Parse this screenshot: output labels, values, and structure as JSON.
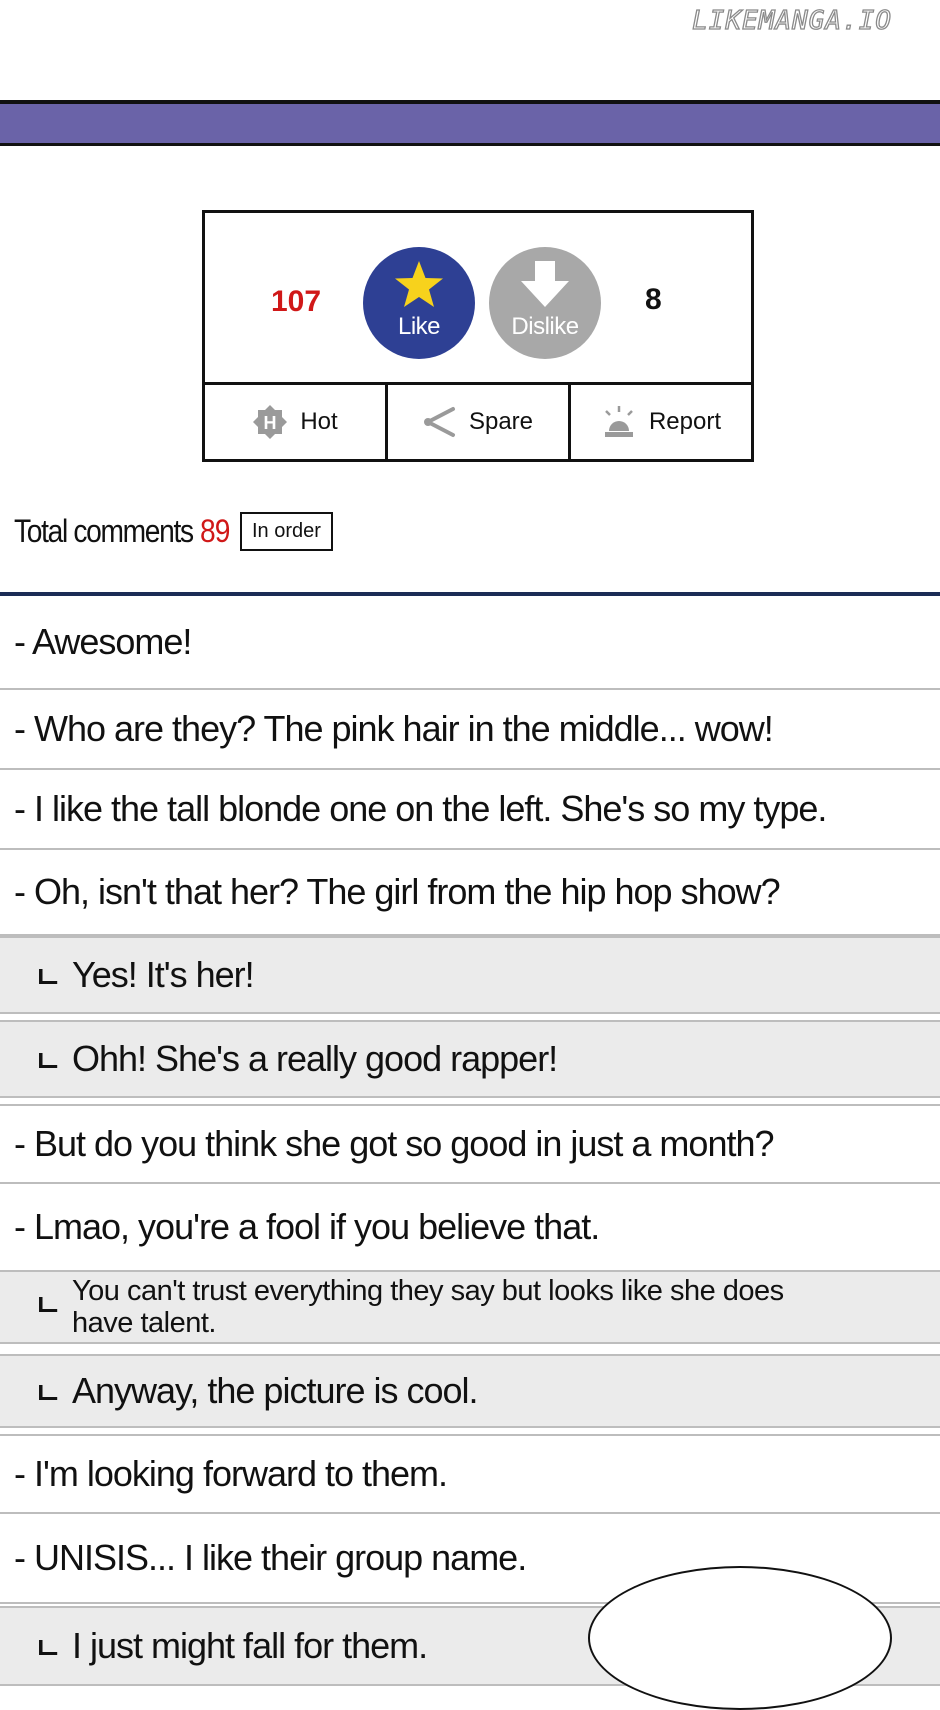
{
  "watermark": "LIKEMANGA.IO",
  "colors": {
    "header_bar": "#6a63a8",
    "like": "#2e4094",
    "dislike": "#a8a8a8",
    "count_red": "#d01818"
  },
  "votes": {
    "like_count": "107",
    "like_label": "Like",
    "like_icon": "star-icon",
    "dislike_label": "Dislike",
    "dislike_icon": "down-arrow-icon",
    "dislike_count": "8"
  },
  "actions": [
    {
      "icon": "hot-badge-icon",
      "label": "Hot"
    },
    {
      "icon": "share-icon",
      "label": "Spare"
    },
    {
      "icon": "siren-icon",
      "label": "Report"
    }
  ],
  "comments_header": {
    "label": "Total comments",
    "count": "89",
    "sort_label": "In order"
  },
  "comments": [
    {
      "type": "main",
      "text": "- Awesome!"
    },
    {
      "type": "main",
      "text": "- Who are they?  The pink hair in the middle... wow!"
    },
    {
      "type": "main",
      "text": "- I like the tall blonde one on the left. She's so my type."
    },
    {
      "type": "main",
      "text": "- Oh, isn't that her?  The girl from the hip hop show?"
    },
    {
      "type": "reply",
      "text": "Yes!  It's her!"
    },
    {
      "type": "reply",
      "text": "Ohh!  She's a really good rapper!"
    },
    {
      "type": "main",
      "text": "- But do you think she got so good in just a month?"
    },
    {
      "type": "main",
      "text": "- Lmao, you're a fool if you believe that."
    },
    {
      "type": "reply",
      "text": "You can't trust everything they say but looks like she does have talent."
    },
    {
      "type": "reply",
      "text": "Anyway, the picture is cool."
    },
    {
      "type": "main",
      "text": "- I'm looking forward to them."
    },
    {
      "type": "main",
      "text": "- UNISIS... I like their group name."
    },
    {
      "type": "reply",
      "text": "I just might fall for them."
    }
  ],
  "reply_marker": "ㄴ"
}
